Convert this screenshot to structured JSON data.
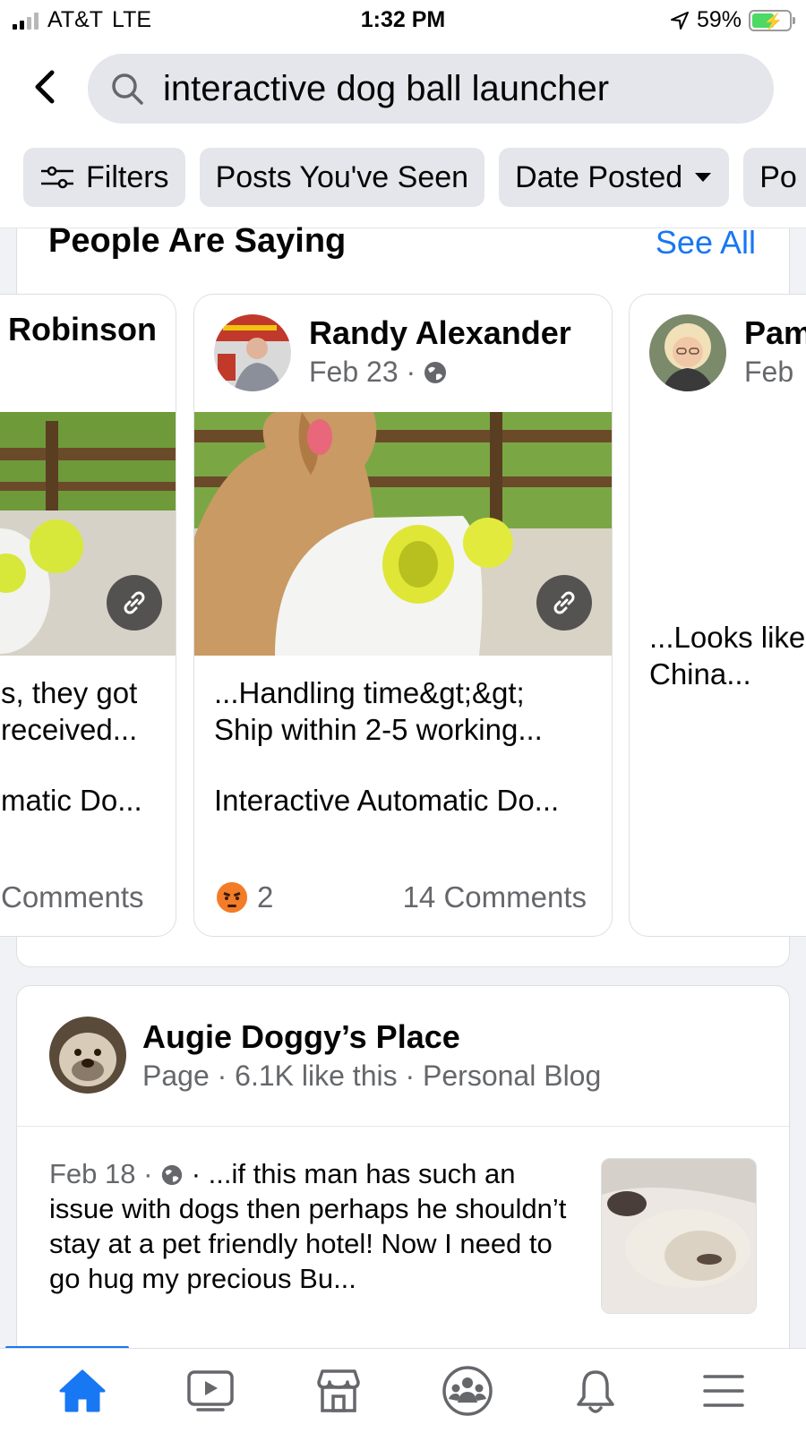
{
  "status_bar": {
    "carrier": "AT&T",
    "network": "LTE",
    "time": "1:32 PM",
    "battery": "59%",
    "battery_level": 0.59
  },
  "search": {
    "query": "interactive dog ball launcher"
  },
  "filters": {
    "chips": [
      "Filters",
      "Posts You've Seen",
      "Date Posted",
      "Po"
    ]
  },
  "people_are_saying": {
    "title": "People Are Saying",
    "see_all": "See All",
    "cards": [
      {
        "author": "Robinson",
        "text_line1": "s, they got",
        "text_line2": " received...",
        "subtitle": "matic Do...",
        "comments": "Comments"
      },
      {
        "author": "Randy Alexander",
        "date": "Feb 23 ·",
        "text_line1": "...Handling time&gt;&gt;",
        "text_line2": "Ship within 2-5 working...",
        "subtitle": "Interactive Automatic Do...",
        "reaction_count": "2",
        "comments": "14 Comments"
      },
      {
        "author": "Pam",
        "date": "Feb ",
        "text_line1": "...Looks like",
        "text_line2": "China..."
      }
    ]
  },
  "result": {
    "name": "Augie Doggy’s Place",
    "meta": "Page · 6.1K like this · Personal Blog",
    "date": "Feb 18 ·",
    "snippet_after_icon": " · ...if this man has such an issue with dogs then perhaps he shouldn’t stay at a pet friendly hotel! Now I need to go hug my precious Bu..."
  },
  "bottom_nav": {
    "items": [
      "home-icon",
      "video-icon",
      "marketplace-icon",
      "groups-icon",
      "notifications-icon",
      "menu-icon"
    ],
    "active": "home-icon"
  },
  "colors": {
    "accent": "#1877f2",
    "secondary_text": "#65676b",
    "chip_bg": "#e4e6eb"
  }
}
